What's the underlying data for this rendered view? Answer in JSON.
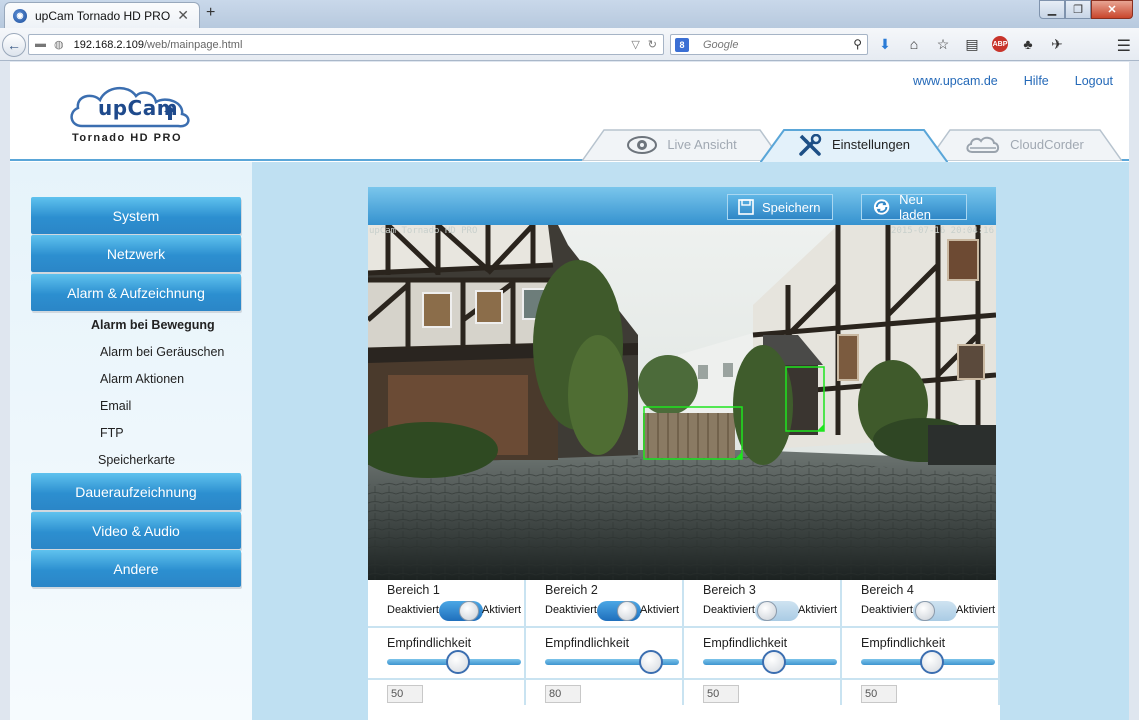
{
  "browser": {
    "tab_title": "upCam Tornado HD PRO",
    "url_host": "192.168.2.109",
    "url_path": "/web/mainpage.html",
    "search_placeholder": "Google"
  },
  "header": {
    "logo_text": "upCam",
    "logo_subtitle": "Tornado HD PRO",
    "links": [
      "www.upcam.de",
      "Hilfe",
      "Logout"
    ],
    "tabs": [
      {
        "label": "Live Ansicht",
        "icon": "eye-icon",
        "active": false
      },
      {
        "label": "Einstellungen",
        "icon": "tools-icon",
        "active": true
      },
      {
        "label": "CloudCorder",
        "icon": "cloud-icon",
        "active": false
      }
    ]
  },
  "sidebar": {
    "buttons": [
      "System",
      "Netzwerk",
      "Alarm & Aufzeichnung",
      "Daueraufzeichnung",
      "Video & Audio",
      "Andere"
    ],
    "sub_items": [
      {
        "label": "Alarm bei Bewegung",
        "active": true
      },
      {
        "label": "Alarm bei Geräuschen",
        "active": false
      },
      {
        "label": "Alarm Aktionen",
        "active": false
      },
      {
        "label": "Email",
        "active": false
      },
      {
        "label": "FTP",
        "active": false
      },
      {
        "label": "Speicherkarte",
        "active": false
      }
    ]
  },
  "toolbar": {
    "save_label": "Speichern",
    "reload_label": "Neu laden"
  },
  "camera": {
    "osd_name": "upCam Tornado HD PRO",
    "osd_time": "2015-07-16 20:04:16",
    "detection_box_color": "#1ee51e"
  },
  "zones": [
    {
      "title": "Bereich 1",
      "off_label": "Deaktiviert",
      "on_label": "Aktiviert",
      "enabled": true,
      "sens_label": "Empfindlichkeit",
      "sensitivity": 50,
      "value": "50"
    },
    {
      "title": "Bereich 2",
      "off_label": "Deaktiviert",
      "on_label": "Aktiviert",
      "enabled": true,
      "sens_label": "Empfindlichkeit",
      "sensitivity": 80,
      "value": "80"
    },
    {
      "title": "Bereich 3",
      "off_label": "Deaktiviert",
      "on_label": "Aktiviert",
      "enabled": false,
      "sens_label": "Empfindlichkeit",
      "sensitivity": 50,
      "value": "50"
    },
    {
      "title": "Bereich 4",
      "off_label": "Deaktiviert",
      "on_label": "Aktiviert",
      "enabled": false,
      "sens_label": "Empfindlichkeit",
      "sensitivity": 50,
      "value": "50"
    }
  ],
  "colors": {
    "accent": "#2c8fd0",
    "link": "#2469b8",
    "panel_bg": "#bfe0f2"
  }
}
